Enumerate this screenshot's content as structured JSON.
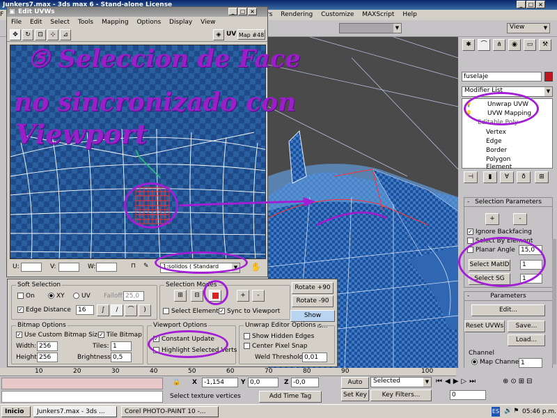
{
  "max_window": {
    "title": "Junkers7.max - 3ds max 6 - Stand-alone License"
  },
  "max_menu": [
    "rs",
    "Rendering",
    "Customize",
    "MAXScript",
    "Help"
  ],
  "max_toolbar": {
    "view_combo": "View"
  },
  "uvw": {
    "title": "Edit UVWs",
    "menu": [
      "File",
      "Edit",
      "Select",
      "Tools",
      "Mapping",
      "Options",
      "Display",
      "View"
    ],
    "toolbar": {
      "uv_label": "UV",
      "map_label": "Map #48"
    },
    "bottom": {
      "u_label": "U:",
      "v_label": "V:",
      "w_label": "W:",
      "material_combo": "1:solidos     ( Standard"
    }
  },
  "annotation": {
    "line1": "⑤ Seleccion de Face",
    "line2": "no sincronizado con",
    "line3": "Viewport"
  },
  "options_panel": {
    "soft_selection": {
      "title": "Soft Selection",
      "on": "On",
      "xy": "XY",
      "uv": "UV",
      "falloff_label": "Falloff",
      "falloff_value": "25,0",
      "edge_distance": "Edge Distance",
      "edge_distance_value": "16"
    },
    "selection_modes": {
      "title": "Selection Modes",
      "select_element": "Select Element",
      "sync": "Sync to Viewport"
    },
    "rotate_plus": "Rotate +90",
    "rotate_minus": "Rotate -90",
    "show_options": "Show Options...",
    "bitmap_options": {
      "title": "Bitmap Options",
      "use_custom": "Use Custom Bitmap Size",
      "tile_bitmap": "Tile Bitmap",
      "width_label": "Width:",
      "width_value": "256",
      "height_label": "Height:",
      "height_value": "256",
      "tiles_label": "Tiles:",
      "tiles_value": "1",
      "brightness_label": "Brightness:",
      "brightness_value": "0,5"
    },
    "viewport_options": {
      "title": "Viewport Options",
      "constant_update": "Constant Update",
      "highlight": "Highlight Selected Verts"
    },
    "unwrap_editor": {
      "title": "Unwrap Editor Options",
      "show_hidden": "Show Hidden Edges",
      "center_pixel": "Center Pixel Snap",
      "weld_label": "Weld Threshold:",
      "weld_value": "0,01"
    }
  },
  "right_panel": {
    "object_name": "fuselaje",
    "modifier_list": "Modifier List",
    "stack": [
      "Unwrap UVW",
      "UVW Mapping",
      "Editable Poly",
      "Vertex",
      "Edge",
      "Border",
      "Polygon",
      "Element"
    ],
    "selection_params": {
      "title": "Selection Parameters",
      "ignore_backfacing": "Ignore Backfacing",
      "select_by_element": "Select By Element",
      "planar_angle": "Planar Angle",
      "planar_value": "15,0",
      "select_matid": "Select MatID",
      "matid_value": "1",
      "select_sg": "Select SG",
      "sg_value": "1"
    },
    "parameters": {
      "title": "Parameters",
      "edit": "Edit...",
      "reset_uvws": "Reset UVWs",
      "save": "Save...",
      "load": "Load...",
      "channel": "Channel",
      "map_channel": "Map Channel:",
      "map_channel_value": "1"
    }
  },
  "timeline": {
    "ticks": [
      "10",
      "20",
      "30",
      "40",
      "50",
      "60",
      "70",
      "80",
      "90",
      "100"
    ],
    "x_value": "-1,154",
    "y_value": "0,0",
    "z_value": "-0,0",
    "status": "Select texture vertices",
    "add_time_tag": "Add Time Tag",
    "auto_key": "Auto Key",
    "set_key": "Set Key",
    "selected": "Selected",
    "key_filters": "Key Filters...",
    "frame_value": "0"
  },
  "taskbar": {
    "start": "Inicio",
    "tasks": [
      "Junkers7.max - 3ds ...",
      "Corel PHOTO-PAINT 10 -..."
    ],
    "lang": "ES",
    "clock": "05:46 p.m."
  },
  "colors": {
    "annotation": "#9b1fc9",
    "selection": "#e02020",
    "uv_grid": "#2a5fa0"
  }
}
